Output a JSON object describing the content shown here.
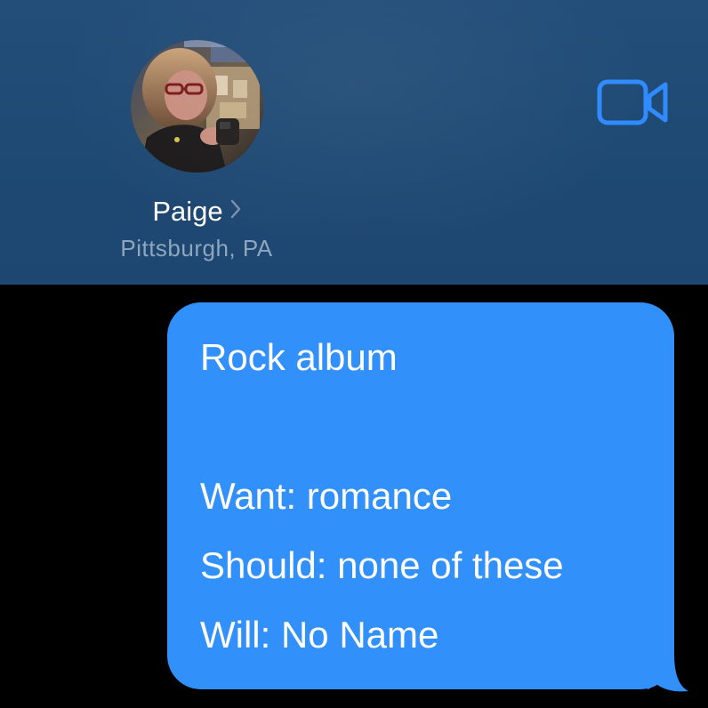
{
  "contact": {
    "name": "Paige",
    "location": "Pittsburgh, PA",
    "avatar_icon": "contact-photo"
  },
  "header": {
    "video_icon": "video-camera-icon",
    "chevron_icon": "chevron-right-icon",
    "accent_color": "#2f8bff"
  },
  "message": {
    "direction": "outgoing",
    "bubble_color": "#3290fb",
    "lines": [
      "Rock album",
      "",
      "Want: romance",
      "Should: none of these",
      "Will: No Name"
    ]
  }
}
